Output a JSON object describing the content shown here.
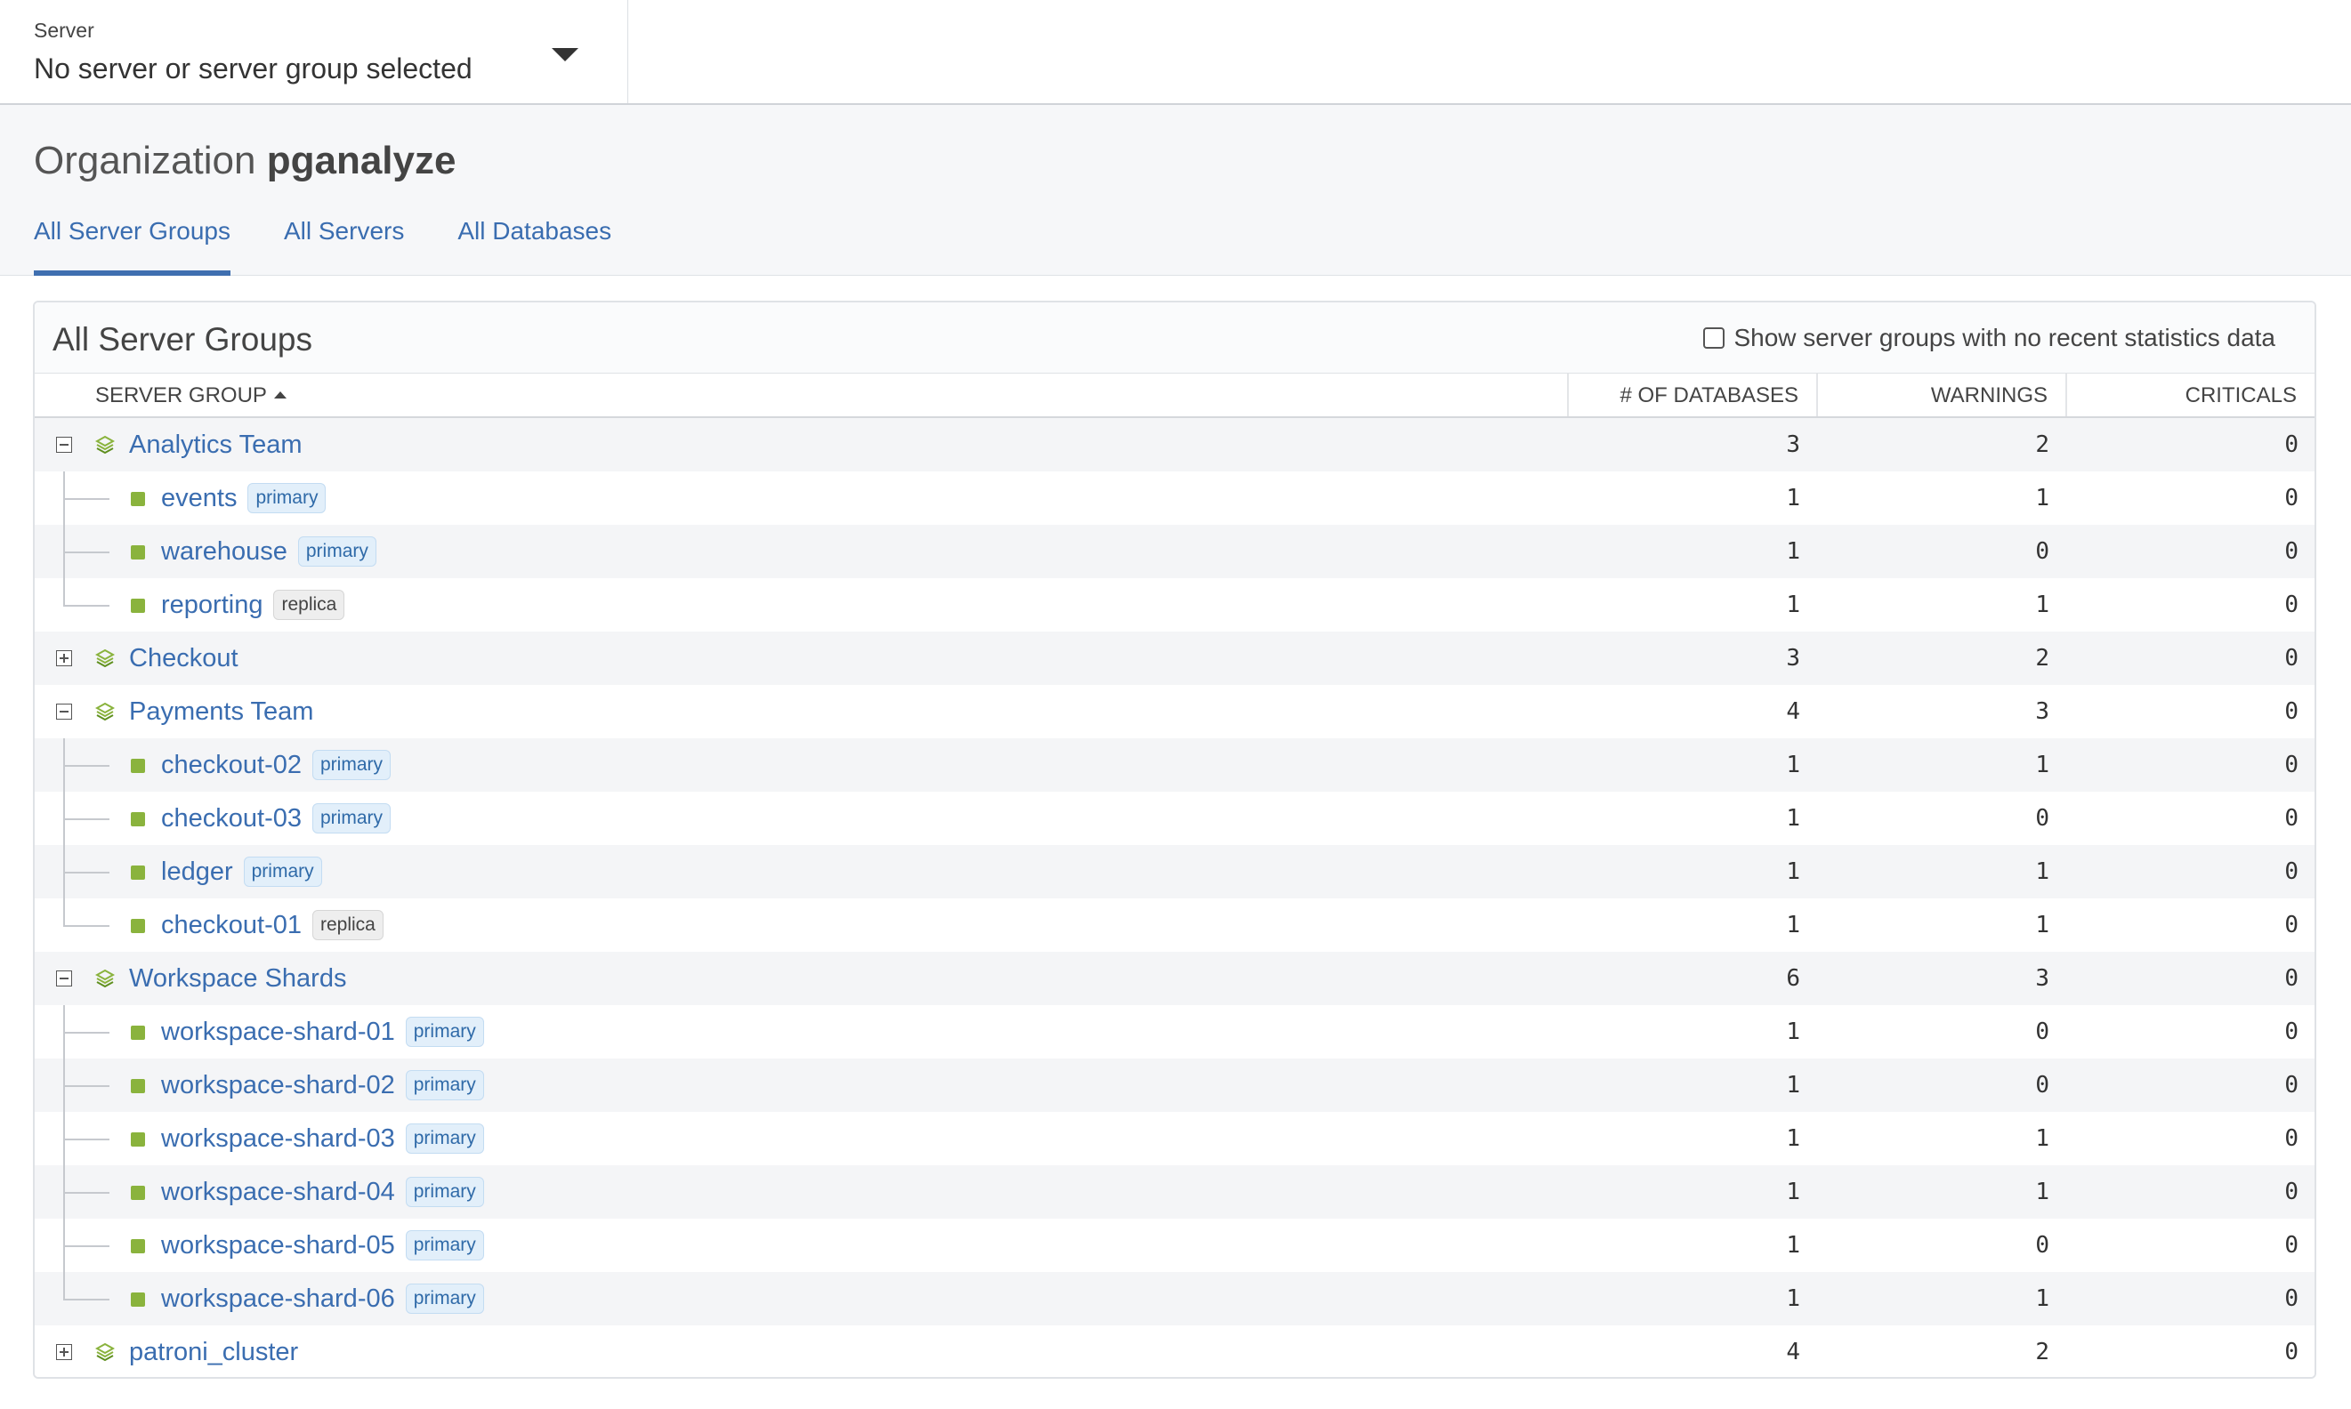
{
  "server_selector": {
    "label": "Server",
    "value": "No server or server group selected"
  },
  "org": {
    "prefix": "Organization",
    "name": "pganalyze"
  },
  "tabs": [
    {
      "label": "All Server Groups",
      "active": true
    },
    {
      "label": "All Servers",
      "active": false
    },
    {
      "label": "All Databases",
      "active": false
    }
  ],
  "panel": {
    "title": "All Server Groups",
    "filter_label": "Show server groups with no recent statistics data"
  },
  "columns": {
    "server_group": "SERVER GROUP",
    "databases": "# OF DATABASES",
    "warnings": "WARNINGS",
    "criticals": "CRITICALS"
  },
  "groups": [
    {
      "name": "Analytics Team",
      "expanded": true,
      "databases": "3",
      "warnings": "2",
      "criticals": "0",
      "servers": [
        {
          "name": "events",
          "role": "primary",
          "databases": "1",
          "warnings": "1",
          "criticals": "0"
        },
        {
          "name": "warehouse",
          "role": "primary",
          "databases": "1",
          "warnings": "0",
          "criticals": "0"
        },
        {
          "name": "reporting",
          "role": "replica",
          "databases": "1",
          "warnings": "1",
          "criticals": "0"
        }
      ]
    },
    {
      "name": "Checkout",
      "expanded": false,
      "databases": "3",
      "warnings": "2",
      "criticals": "0",
      "servers": []
    },
    {
      "name": "Payments Team",
      "expanded": true,
      "databases": "4",
      "warnings": "3",
      "criticals": "0",
      "servers": [
        {
          "name": "checkout-02",
          "role": "primary",
          "databases": "1",
          "warnings": "1",
          "criticals": "0"
        },
        {
          "name": "checkout-03",
          "role": "primary",
          "databases": "1",
          "warnings": "0",
          "criticals": "0"
        },
        {
          "name": "ledger",
          "role": "primary",
          "databases": "1",
          "warnings": "1",
          "criticals": "0"
        },
        {
          "name": "checkout-01",
          "role": "replica",
          "databases": "1",
          "warnings": "1",
          "criticals": "0"
        }
      ]
    },
    {
      "name": "Workspace Shards",
      "expanded": true,
      "databases": "6",
      "warnings": "3",
      "criticals": "0",
      "servers": [
        {
          "name": "workspace-shard-01",
          "role": "primary",
          "databases": "1",
          "warnings": "0",
          "criticals": "0"
        },
        {
          "name": "workspace-shard-02",
          "role": "primary",
          "databases": "1",
          "warnings": "0",
          "criticals": "0"
        },
        {
          "name": "workspace-shard-03",
          "role": "primary",
          "databases": "1",
          "warnings": "1",
          "criticals": "0"
        },
        {
          "name": "workspace-shard-04",
          "role": "primary",
          "databases": "1",
          "warnings": "1",
          "criticals": "0"
        },
        {
          "name": "workspace-shard-05",
          "role": "primary",
          "databases": "1",
          "warnings": "0",
          "criticals": "0"
        },
        {
          "name": "workspace-shard-06",
          "role": "primary",
          "databases": "1",
          "warnings": "1",
          "criticals": "0"
        }
      ]
    },
    {
      "name": "patroni_cluster",
      "expanded": false,
      "databases": "4",
      "warnings": "2",
      "criticals": "0",
      "servers": []
    }
  ],
  "colors": {
    "link": "#3a6db0",
    "server_status": "#8ab33d",
    "group_icon": "#8ab33d",
    "group_icon_dark": "#5f8f1f"
  }
}
